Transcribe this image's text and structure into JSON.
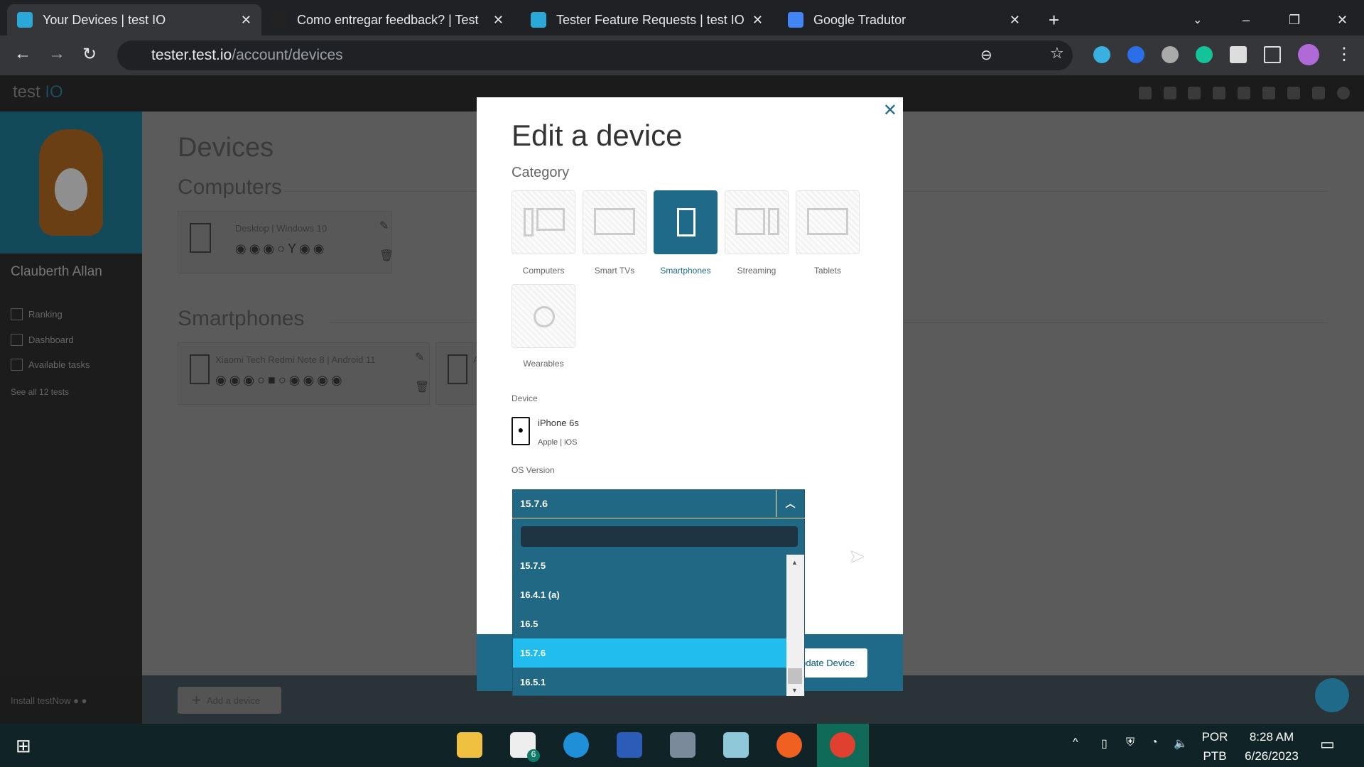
{
  "browser": {
    "tabs": [
      {
        "title": "Your Devices | test IO",
        "active": true
      },
      {
        "title": "Como entregar feedback? | Test I"
      },
      {
        "title": "Tester Feature Requests | test IO"
      },
      {
        "title": "Google Tradutor"
      }
    ],
    "url_host": "tester.test.io",
    "url_path": "/account/devices"
  },
  "app": {
    "logo_a": "test",
    "logo_b": "IO"
  },
  "sidebar": {
    "user": "Clauberth Allan",
    "items": [
      {
        "label": "Ranking",
        "icon": "ranking-icon"
      },
      {
        "label": "Dashboard",
        "icon": "home-icon"
      },
      {
        "label": "Available tasks",
        "icon": "tasks-icon"
      }
    ],
    "see_all": "See all 12 tests",
    "install": "Install testNow"
  },
  "page": {
    "title": "Devices",
    "sections": [
      {
        "title": "Computers",
        "devices": [
          {
            "name": "Desktop | Windows 10"
          }
        ]
      },
      {
        "title": "Smartphones",
        "devices": [
          {
            "name": "Xiaomi Tech Redmi Note 8 | Android 11"
          },
          {
            "name": "Ap"
          }
        ]
      }
    ],
    "add_device": "Add a device"
  },
  "modal": {
    "title": "Edit a device",
    "category_label": "Category",
    "categories": [
      {
        "label": "Computers"
      },
      {
        "label": "Smart TVs"
      },
      {
        "label": "Smartphones",
        "selected": true
      },
      {
        "label": "Streaming"
      },
      {
        "label": "Tablets"
      },
      {
        "label": "Wearables"
      }
    ],
    "device_label": "Device",
    "device_name": "iPhone 6s",
    "device_sub": "Apple | iOS",
    "os_label": "OS Version",
    "os_selected": "15.7.6",
    "os_options": [
      "15.7.5",
      "16.4.1 (a)",
      "16.5",
      "15.7.6",
      "16.5.1"
    ],
    "os_highlighted": "15.7.6",
    "update_button": "Update Device",
    "update_visible": "date Device"
  },
  "taskbar": {
    "lang1": "POR",
    "lang2": "PTB",
    "time": "8:28 AM",
    "date": "6/26/2023",
    "mail_badge": "6"
  },
  "colors": {
    "accent": "#1f6a88",
    "highlight": "#21bdee"
  }
}
